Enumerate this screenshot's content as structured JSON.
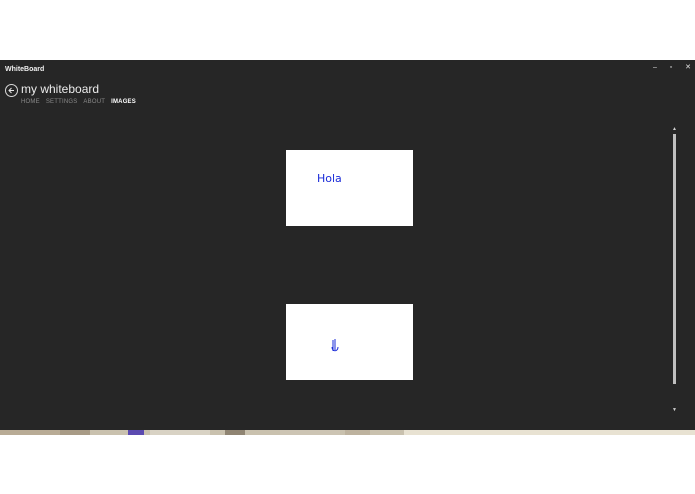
{
  "window": {
    "app_title": "WhiteBoard",
    "controls": {
      "minimize": "–",
      "maximize": "▫",
      "close": "✕"
    }
  },
  "header": {
    "back_icon": "back-arrow-icon",
    "title": "my whiteboard",
    "nav": [
      {
        "label": "HOME",
        "active": false
      },
      {
        "label": "SETTINGS",
        "active": false
      },
      {
        "label": "ABOUT",
        "active": false
      },
      {
        "label": "IMAGES",
        "active": true
      }
    ]
  },
  "images": [
    {
      "drawing": "Hola"
    },
    {
      "drawing": ""
    }
  ],
  "colors": {
    "background": "#262626",
    "ink": "#1a2bd8",
    "card": "#ffffff"
  }
}
